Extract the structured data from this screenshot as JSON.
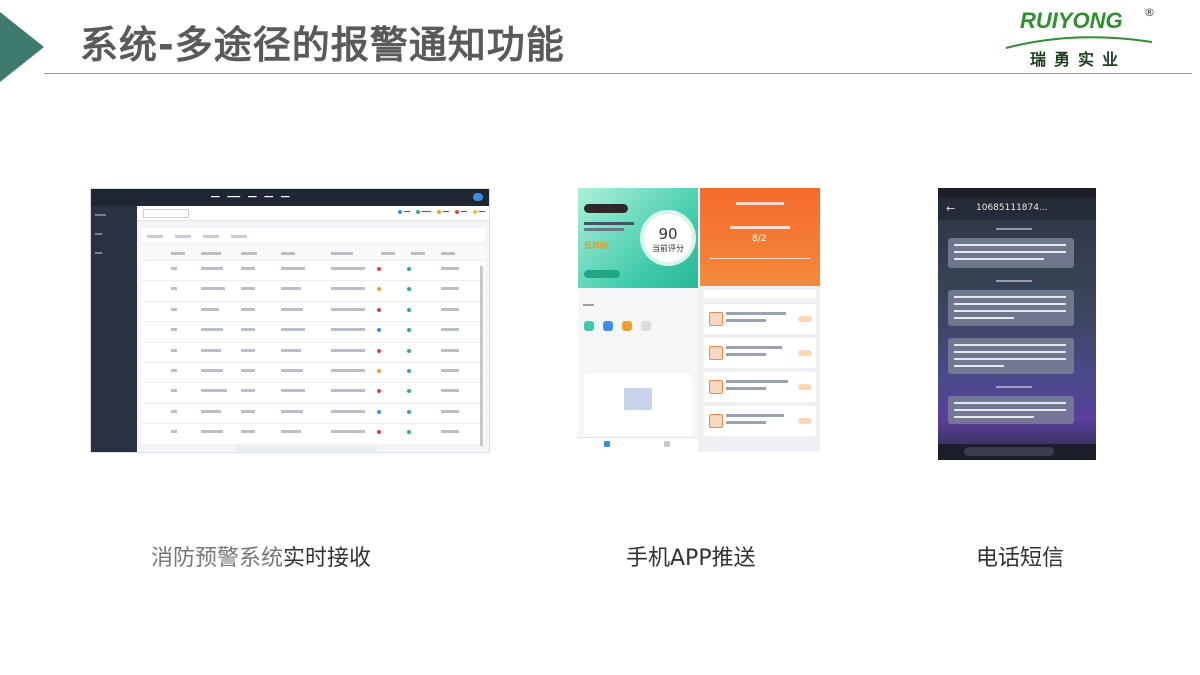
{
  "slide": {
    "title": "系统-多途径的报警通知功能"
  },
  "logo": {
    "brand": "RUIYONG",
    "registered": "®",
    "chinese": "瑞勇实业",
    "colors": {
      "brand": "#2f8f2f",
      "accent": "#3f7a6e"
    }
  },
  "panels": {
    "desktop": {
      "score_hint": ""
    },
    "mobile": {
      "score": "90",
      "score_label": "当前评分",
      "warning": "低风险",
      "big_value": "8/2"
    },
    "sms": {
      "number": "10685111874..."
    }
  },
  "captions": {
    "desktop_part1": "消防预警系统",
    "desktop_part2": "实时接收",
    "mobile": "手机APP推送",
    "sms": "电话短信"
  }
}
